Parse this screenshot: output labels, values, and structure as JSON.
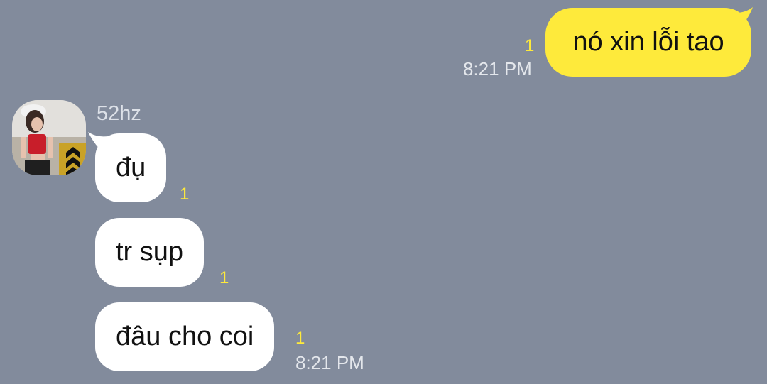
{
  "colors": {
    "background": "#828B9C",
    "my_bubble": "#FEEA3B",
    "their_bubble": "#FFFFFF",
    "unread_indicator": "#FEEA3B"
  },
  "conversation": {
    "outgoing": [
      {
        "text": "nó xin lỗi tao",
        "unread": "1",
        "time": "8:21 PM"
      }
    ],
    "incoming": {
      "sender_name": "52hz",
      "avatar_icon": "user-avatar-photo",
      "messages": [
        {
          "text": "đụ",
          "unread": "1"
        },
        {
          "text": "tr sụp",
          "unread": "1"
        },
        {
          "text": "đâu cho coi",
          "unread": "1",
          "time": "8:21 PM"
        }
      ]
    }
  }
}
